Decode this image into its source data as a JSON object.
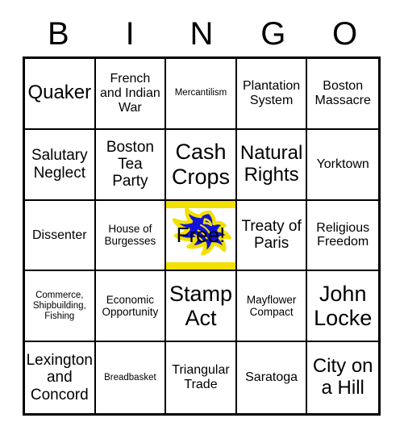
{
  "header": {
    "letters": [
      "B",
      "I",
      "N",
      "G",
      "O"
    ]
  },
  "card": {
    "free_space": {
      "label": "Free!",
      "logo_icon": "lion-mascot-icon",
      "logo_colors": {
        "body": "#1212d8",
        "outline": "#f2e000",
        "band": "#f2e000",
        "background": "#ffffff"
      }
    },
    "colors": {
      "border": "#000000",
      "cell_background": "#ffffff",
      "text": "#000000",
      "accent_yellow": "#f2e000",
      "accent_blue": "#1212d8"
    },
    "rows": [
      [
        {
          "text": "Quaker",
          "size": "xl"
        },
        {
          "text": "French and Indian War",
          "size": "md"
        },
        {
          "text": "Mercantilism",
          "size": "xs"
        },
        {
          "text": "Plantation System",
          "size": "md"
        },
        {
          "text": "Boston Massacre",
          "size": "md"
        }
      ],
      [
        {
          "text": "Salutary Neglect",
          "size": "lg"
        },
        {
          "text": "Boston Tea Party",
          "size": "lg"
        },
        {
          "text": "Cash Crops",
          "size": "xxl"
        },
        {
          "text": "Natural Rights",
          "size": "xl"
        },
        {
          "text": "Yorktown",
          "size": "md"
        }
      ],
      [
        {
          "text": "Dissenter",
          "size": "md"
        },
        {
          "text": "House of Burgesses",
          "size": "sm"
        },
        {
          "text": "Free!",
          "size": "free"
        },
        {
          "text": "Treaty of Paris",
          "size": "lg"
        },
        {
          "text": "Religious Freedom",
          "size": "md"
        }
      ],
      [
        {
          "text": "Commerce, Shipbuilding, Fishing",
          "size": "xs"
        },
        {
          "text": "Economic Opportunity",
          "size": "sm"
        },
        {
          "text": "Stamp Act",
          "size": "xxl"
        },
        {
          "text": "Mayflower Compact",
          "size": "sm"
        },
        {
          "text": "John Locke",
          "size": "xxl"
        }
      ],
      [
        {
          "text": "Lexington and Concord",
          "size": "lg"
        },
        {
          "text": "Breadbasket",
          "size": "xs"
        },
        {
          "text": "Triangular Trade",
          "size": "md"
        },
        {
          "text": "Saratoga",
          "size": "md"
        },
        {
          "text": "City on a Hill",
          "size": "xl"
        }
      ]
    ]
  }
}
